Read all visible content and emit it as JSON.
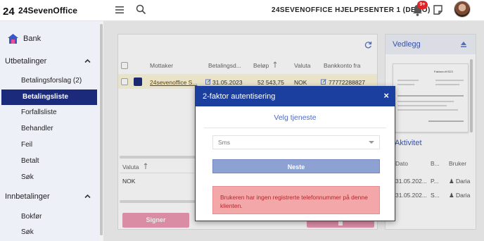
{
  "brand": {
    "name": "24SevenOffice",
    "mark": "24"
  },
  "topbar": {
    "company": "24SEVENOFFICE HJELPESENTER 1 (DEMO)",
    "notification_count": "9+"
  },
  "sidebar": {
    "module": "Bank",
    "sections": [
      {
        "label": "Utbetalinger",
        "expanded": true,
        "items": [
          "Betalingsforslag (2)",
          "Betalingsliste",
          "Forfallsliste",
          "Behandler",
          "Feil",
          "Betalt",
          "Søk"
        ],
        "active": "Betalingsliste"
      },
      {
        "label": "Innbetalinger",
        "expanded": true,
        "items": [
          "Bokfør",
          "Søk"
        ]
      }
    ]
  },
  "payments_table": {
    "headers": [
      "Mottaker",
      "Betalingsd...",
      "Beløp",
      "Valuta",
      "Bankkonto fra"
    ],
    "rows": [
      {
        "recipient": "24sevenoffice S...",
        "date": "31.05.2023",
        "amount": "52 543,75",
        "currency": "NOK",
        "account": "77772288827"
      }
    ]
  },
  "subtable": {
    "header": "Valuta",
    "rows": [
      "NOK"
    ]
  },
  "actions": {
    "sign": "Signer"
  },
  "attachments": {
    "title": "Vedlegg",
    "doc_title": "Faktura #VS23"
  },
  "activity": {
    "title": "Aktivitet",
    "headers": [
      "Dato",
      "B...",
      "Bruker"
    ],
    "rows": [
      {
        "date": "31.05.202...",
        "b": "P...",
        "user": "Daria"
      },
      {
        "date": "31.05.202...",
        "b": "S...",
        "user": "Daria"
      }
    ]
  },
  "modal": {
    "title": "2-faktor autentisering",
    "close": "×",
    "subtitle": "Velg tjeneste",
    "select_value": "Sms",
    "next_button": "Neste",
    "alert": "Brukeren har ingen registrerte telefonnummer på denne klienten."
  },
  "colors": {
    "primary": "#1b3f9e",
    "nav_active": "#1b2a7a",
    "sidebar_bg": "#eef0f8",
    "sign_button": "#ee98b3",
    "alert_bg": "#f3a7a8",
    "alert_text": "#b3272d",
    "next_button": "#8ea1d3"
  }
}
